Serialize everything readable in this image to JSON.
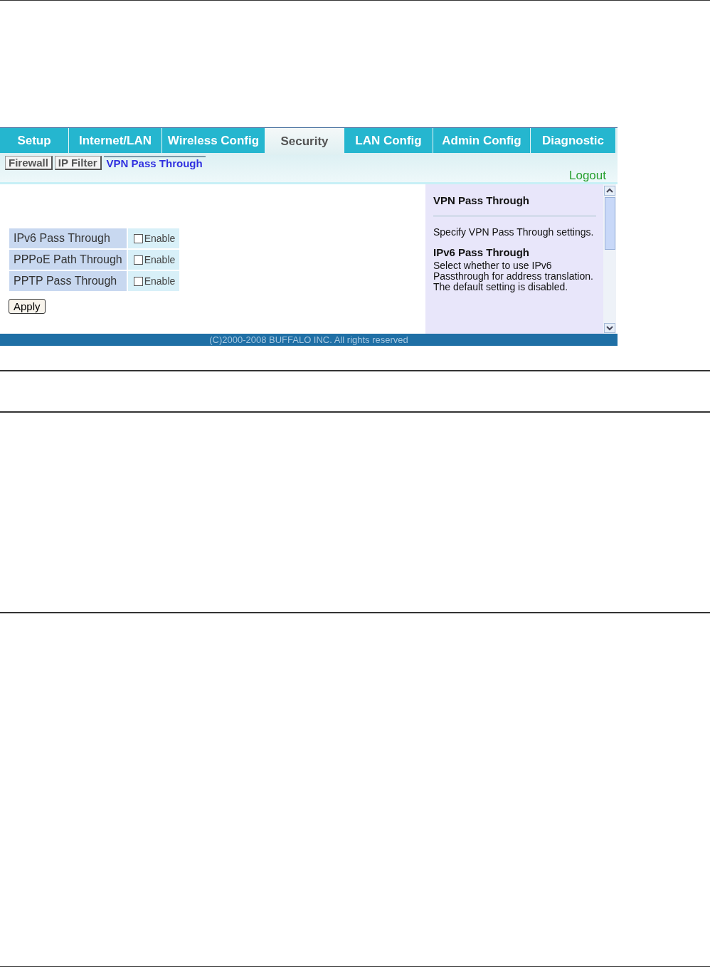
{
  "tabs": [
    {
      "label": "Setup",
      "selected": false
    },
    {
      "label": "Internet/LAN",
      "selected": false
    },
    {
      "label": "Wireless Config",
      "selected": false
    },
    {
      "label": "Security",
      "selected": true
    },
    {
      "label": "LAN Config",
      "selected": false
    },
    {
      "label": "Admin Config",
      "selected": false
    },
    {
      "label": "Diagnostic",
      "selected": false
    }
  ],
  "subtabs": [
    {
      "label": "Firewall",
      "selected": false
    },
    {
      "label": "IP Filter",
      "selected": false
    },
    {
      "label": "VPN Pass Through",
      "selected": true
    }
  ],
  "logout": "Logout",
  "settings": [
    {
      "label": "IPv6 Pass Through",
      "option": "Enable",
      "checked": false
    },
    {
      "label": "PPPoE Path Through",
      "option": "Enable",
      "checked": false
    },
    {
      "label": "PPTP Pass Through",
      "option": "Enable",
      "checked": false
    }
  ],
  "apply": "Apply",
  "help": {
    "title": "VPN Pass Through",
    "intro": "Specify VPN Pass Through settings.",
    "sections": [
      {
        "heading": "IPv6 Pass Through",
        "text": "Select whether to use IPv6 Passthrough for address translation. The default setting is disabled."
      }
    ]
  },
  "footer": "(C)2000-2008 BUFFALO INC. All rights reserved"
}
